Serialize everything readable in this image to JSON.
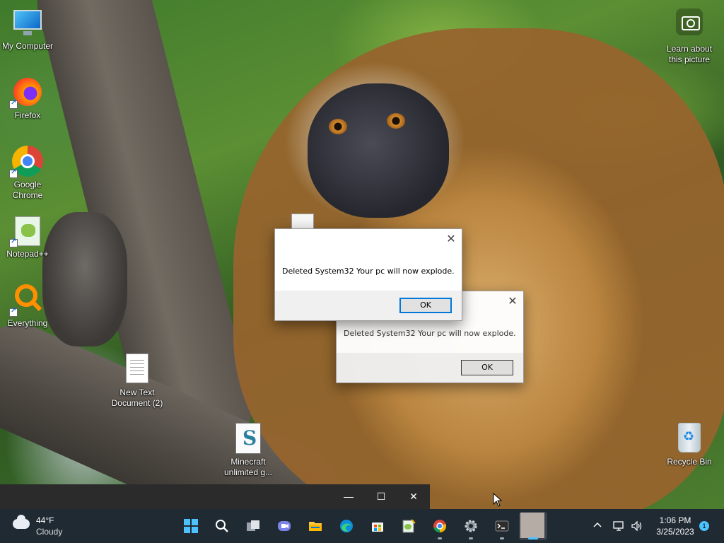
{
  "desktop": {
    "icons": [
      {
        "label": "My Computer",
        "icon": "computer-icon"
      },
      {
        "label": "Firefox",
        "icon": "firefox-icon"
      },
      {
        "label": "Google Chrome",
        "icon": "chrome-icon"
      },
      {
        "label": "Notepad++",
        "icon": "notepadpp-icon"
      },
      {
        "label": "Everything",
        "icon": "everything-icon"
      },
      {
        "label": "New Text Document (2)",
        "icon": "text-document-icon"
      },
      {
        "label": "Minecraft unlimited g...",
        "icon": "batch-file-icon"
      },
      {
        "label": "Learn about this picture",
        "icon": "camera-icon"
      },
      {
        "label": "Recycle Bin",
        "icon": "recycle-bin-icon"
      }
    ]
  },
  "dialogs": [
    {
      "message": "Deleted System32 Your pc will now explode.",
      "ok_label": "OK",
      "close_glyph": "✕"
    },
    {
      "message": "Deleted System32 Your pc will now explode.",
      "ok_label": "OK",
      "close_glyph": "✕"
    }
  ],
  "window_controls": {
    "minimize": "—",
    "maximize": "☐",
    "close": "✕"
  },
  "taskbar": {
    "weather": {
      "temp": "44°F",
      "condition": "Cloudy"
    },
    "apps": [
      "start-icon",
      "search-icon",
      "task-view-icon",
      "teams-chat-icon",
      "file-explorer-icon",
      "edge-icon",
      "store-icon",
      "notepadpp-icon",
      "chrome-icon",
      "settings-icon",
      "terminal-icon",
      "app-icon"
    ],
    "clock": {
      "time": "1:06 PM",
      "date": "3/25/2023"
    },
    "notifications": "1",
    "accent": "#4cc2ff"
  }
}
